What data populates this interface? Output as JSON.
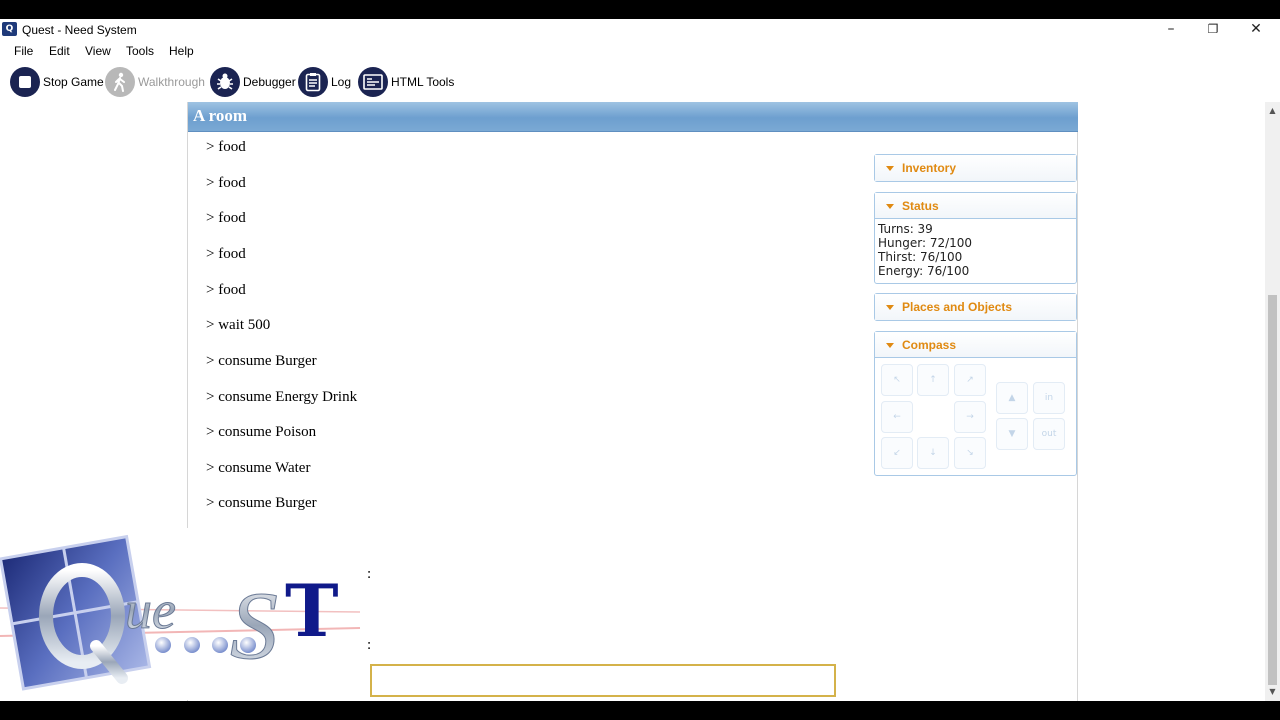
{
  "window": {
    "title": "Quest - Need System",
    "app_icon_glyph": "Q",
    "minimize_glyph": "–",
    "maximize_glyph": "❐",
    "close_glyph": "✕"
  },
  "menu": [
    "File",
    "Edit",
    "View",
    "Tools",
    "Help"
  ],
  "toolbar": {
    "stop_game": "Stop Game",
    "walkthrough": "Walkthrough",
    "debugger": "Debugger",
    "log": "Log",
    "html_tools": "HTML Tools"
  },
  "location": "A room",
  "transcript": [
    "> food",
    "> food",
    "> food",
    "> food",
    "> food",
    "> wait 500",
    "> consume Burger",
    "> consume Energy Drink",
    "> consume Poison",
    "> consume Water",
    "> consume Burger"
  ],
  "partial_lines": [
    ":",
    ":"
  ],
  "panes": {
    "inventory": "Inventory",
    "status": "Status",
    "places": "Places and Objects",
    "compass": "Compass"
  },
  "status_lines": [
    "Turns: 39",
    "Hunger: 72/100",
    "Thirst: 76/100",
    "Energy: 76/100"
  ],
  "compass": {
    "nw": "↖",
    "n": "↑",
    "ne": "↗",
    "w": "←",
    "e": "→",
    "sw": "↙",
    "s": "↓",
    "se": "↘",
    "up": "▲",
    "down": "▼",
    "in": "in",
    "out": "out"
  },
  "logo_text": "QuesT",
  "colors": {
    "accent": "#e08a12",
    "location_bar": "#7aa9d4",
    "toolbar_icon": "#1b2452",
    "input_border": "#d4b24a"
  }
}
